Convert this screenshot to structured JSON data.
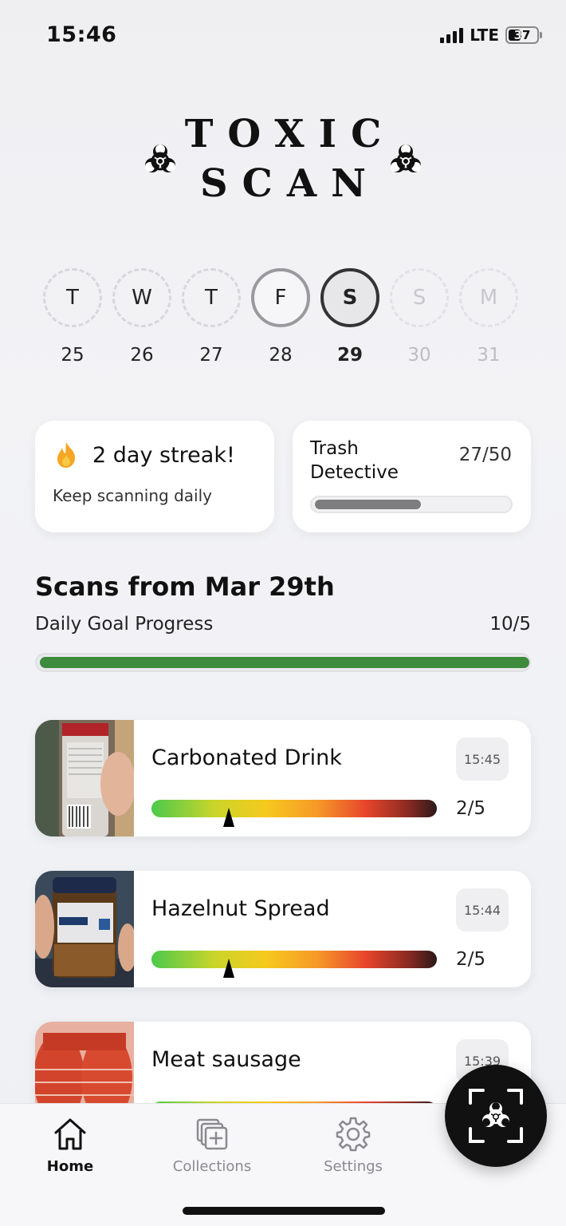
{
  "status": {
    "time": "15:46",
    "network": "LTE",
    "battery": "37"
  },
  "app": {
    "logo_line1": "TOXIC",
    "logo_line2": "SCAN"
  },
  "week": [
    {
      "letter": "T",
      "date": "25",
      "state": "past"
    },
    {
      "letter": "W",
      "date": "26",
      "state": "past"
    },
    {
      "letter": "T",
      "date": "27",
      "state": "past"
    },
    {
      "letter": "F",
      "date": "28",
      "state": "done"
    },
    {
      "letter": "S",
      "date": "29",
      "state": "today"
    },
    {
      "letter": "S",
      "date": "30",
      "state": "future"
    },
    {
      "letter": "M",
      "date": "31",
      "state": "future"
    }
  ],
  "streak": {
    "title": "2 day streak!",
    "subtitle": "Keep scanning daily",
    "icon": "flame-icon"
  },
  "badge": {
    "title": "Trash Detective",
    "count": "27/50",
    "progress": 0.54
  },
  "scans_section": {
    "title": "Scans from Mar 29th",
    "goal_label": "Daily Goal Progress",
    "goal_count": "10/5",
    "goal_progress": 1.0
  },
  "scans": [
    {
      "name": "Carbonated Drink",
      "time": "15:45",
      "score": "2/5",
      "rating": 0.27
    },
    {
      "name": "Hazelnut Spread",
      "time": "15:44",
      "score": "2/5",
      "rating": 0.27
    },
    {
      "name": "Meat sausage",
      "time": "15:39",
      "score": "",
      "rating": 0
    }
  ],
  "nav": [
    {
      "label": "Home",
      "icon": "home-icon",
      "active": true
    },
    {
      "label": "Collections",
      "icon": "collections-icon",
      "active": false
    },
    {
      "label": "Settings",
      "icon": "gear-icon",
      "active": false
    }
  ],
  "colors": {
    "goal_bar": "#3d8b3d",
    "badge_bar": "#7d7d80",
    "accent": "#111111"
  }
}
